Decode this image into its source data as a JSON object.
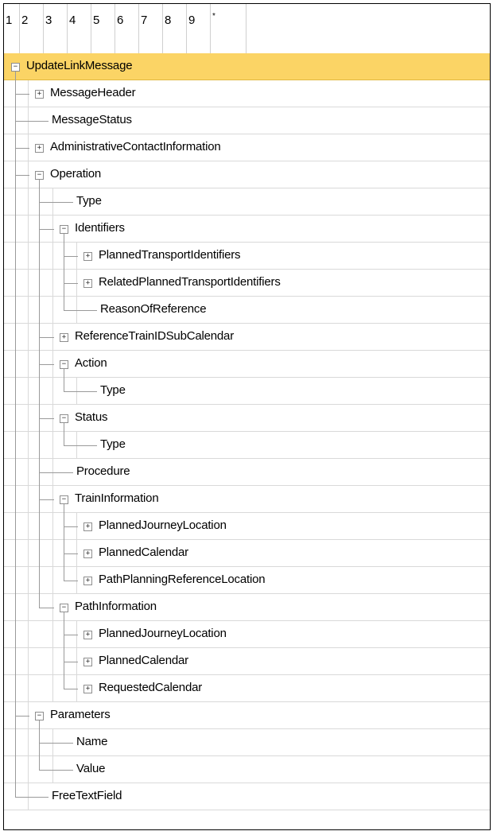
{
  "levels": [
    "1",
    "2",
    "3",
    "4",
    "5",
    "6",
    "7",
    "8",
    "9",
    "*"
  ],
  "nodes": [
    {
      "label": "UpdateLinkMessage",
      "depth": 0,
      "toggle": "collapse",
      "selected": true
    },
    {
      "label": "MessageHeader",
      "depth": 1,
      "toggle": "expand"
    },
    {
      "label": "MessageStatus",
      "depth": 1,
      "toggle": null
    },
    {
      "label": "AdministrativeContactInformation",
      "depth": 1,
      "toggle": "expand"
    },
    {
      "label": "Operation",
      "depth": 1,
      "toggle": "collapse"
    },
    {
      "label": "Type",
      "depth": 2,
      "toggle": null
    },
    {
      "label": "Identifiers",
      "depth": 2,
      "toggle": "collapse"
    },
    {
      "label": "PlannedTransportIdentifiers",
      "depth": 3,
      "toggle": "expand"
    },
    {
      "label": "RelatedPlannedTransportIdentifiers",
      "depth": 3,
      "toggle": "expand"
    },
    {
      "label": "ReasonOfReference",
      "depth": 3,
      "toggle": null
    },
    {
      "label": "ReferenceTrainIDSubCalendar",
      "depth": 2,
      "toggle": "expand"
    },
    {
      "label": "Action",
      "depth": 2,
      "toggle": "collapse"
    },
    {
      "label": "Type",
      "depth": 3,
      "toggle": null
    },
    {
      "label": "Status",
      "depth": 2,
      "toggle": "collapse"
    },
    {
      "label": "Type",
      "depth": 3,
      "toggle": null
    },
    {
      "label": "Procedure",
      "depth": 2,
      "toggle": null
    },
    {
      "label": "TrainInformation",
      "depth": 2,
      "toggle": "collapse"
    },
    {
      "label": "PlannedJourneyLocation",
      "depth": 3,
      "toggle": "expand"
    },
    {
      "label": "PlannedCalendar",
      "depth": 3,
      "toggle": "expand"
    },
    {
      "label": "PathPlanningReferenceLocation",
      "depth": 3,
      "toggle": "expand"
    },
    {
      "label": "PathInformation",
      "depth": 2,
      "toggle": "collapse"
    },
    {
      "label": "PlannedJourneyLocation",
      "depth": 3,
      "toggle": "expand"
    },
    {
      "label": "PlannedCalendar",
      "depth": 3,
      "toggle": "expand"
    },
    {
      "label": "RequestedCalendar",
      "depth": 3,
      "toggle": "expand"
    },
    {
      "label": "Parameters",
      "depth": 1,
      "toggle": "collapse"
    },
    {
      "label": "Name",
      "depth": 2,
      "toggle": null
    },
    {
      "label": "Value",
      "depth": 2,
      "toggle": null
    },
    {
      "label": "FreeTextField",
      "depth": 1,
      "toggle": null
    }
  ],
  "icons": {
    "expand": "plus-box-icon",
    "collapse": "minus-box-icon"
  },
  "colors": {
    "selected_row": "#fbd465",
    "grid": "#d9d9d9",
    "tree_lines": "#9a9a9a"
  }
}
